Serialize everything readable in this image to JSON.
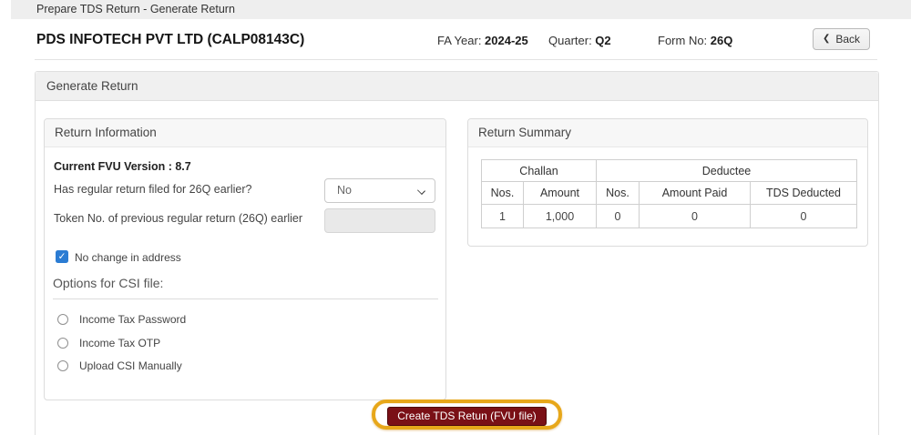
{
  "topbar": {
    "title": "Prepare TDS Return - Generate Return"
  },
  "header": {
    "company": "PDS INFOTECH PVT LTD (CALP08143C)",
    "fa_year_label": "FA Year: ",
    "fa_year_value": "2024-25",
    "quarter_label": "Quarter: ",
    "quarter_value": "Q2",
    "form_label": "Form No: ",
    "form_value": "26Q",
    "back_chevron": "❮",
    "back_label": "Back"
  },
  "section": {
    "title": "Generate Return"
  },
  "return_info": {
    "title": "Return Information",
    "fvu_version": "Current FVU Version : 8.7",
    "regular_question": "Has regular return filed for 26Q earlier?",
    "regular_value": "No",
    "token_label": "Token No. of previous regular return (26Q) earlier",
    "token_value": "",
    "address_checkbox_label": "No change in address",
    "address_checkbox_checked": "✓",
    "csi_title": "Options for CSI file:",
    "csi_options": [
      "Income Tax Password",
      "Income Tax OTP",
      "Upload CSI Manually"
    ]
  },
  "return_summary": {
    "title": "Return Summary",
    "table": {
      "groups": [
        {
          "label": "Challan"
        },
        {
          "label": "Deductee"
        }
      ],
      "columns": [
        "Nos.",
        "Amount",
        "Nos.",
        "Amount Paid",
        "TDS Deducted"
      ],
      "rows": [
        [
          "1",
          "1,000",
          "0",
          "0",
          "0"
        ]
      ]
    }
  },
  "footer": {
    "create_button_label": "Create TDS Retun (FVU file)"
  },
  "colors": {
    "accent_maroon": "#7a1016",
    "highlight_ring": "#e7a71a",
    "checkbox_blue": "#2b7cd3",
    "topbar_gray": "#eeeeee"
  }
}
